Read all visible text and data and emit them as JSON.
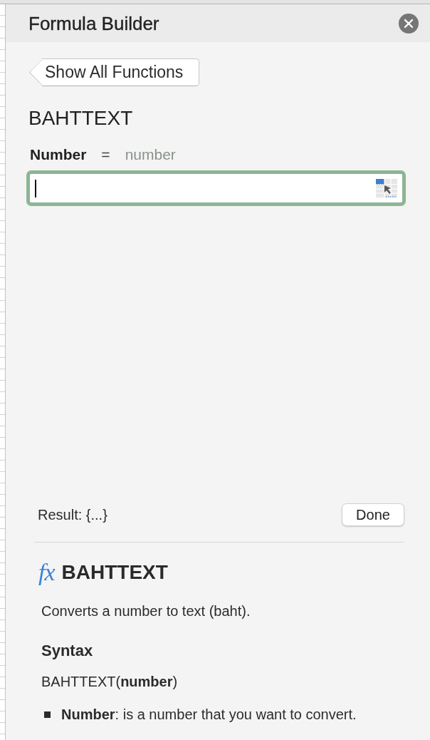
{
  "panel": {
    "title": "Formula Builder"
  },
  "back_button": {
    "label": "Show All Functions"
  },
  "function_name": "BAHTTEXT",
  "arguments": [
    {
      "label": "Number",
      "equals": "=",
      "type_hint": "number",
      "focused": true
    }
  ],
  "result": {
    "label": "Result: {...}"
  },
  "done_button": {
    "label": "Done"
  },
  "help": {
    "icon_glyph": "fx",
    "title": "BAHTTEXT",
    "description": "Converts a number to text (baht).",
    "syntax_heading": "Syntax",
    "syntax": "BAHTTEXT(**number**)",
    "arguments": [
      {
        "text": "**Number**: is a number that you want to convert."
      }
    ]
  }
}
